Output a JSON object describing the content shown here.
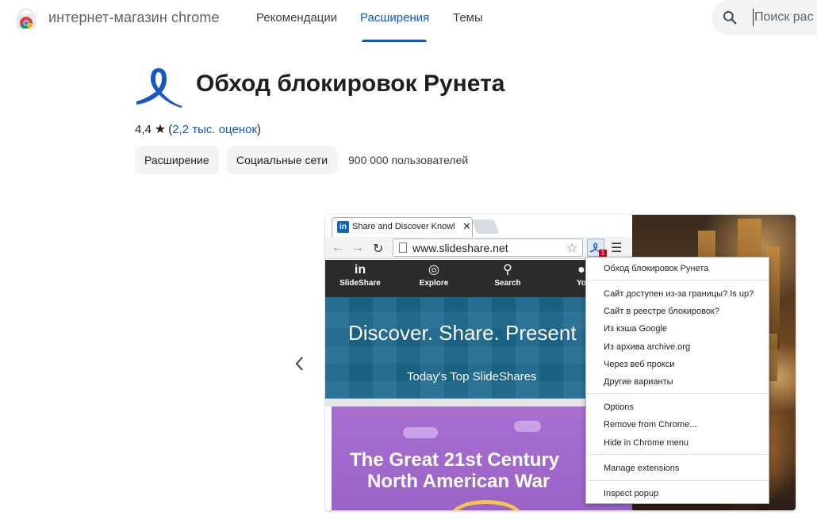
{
  "header": {
    "store_title": "интернет-магазин chrome",
    "tabs": [
      {
        "label": "Рекомендации"
      },
      {
        "label": "Расширения"
      },
      {
        "label": "Темы"
      }
    ],
    "active_tab": "Расширения",
    "search_placeholder": "Поиск рас"
  },
  "extension": {
    "title": "Обход блокировок Рунета",
    "rating": "4,4",
    "rating_count": "2,2 тыс. оценок",
    "chips": [
      "Расширение",
      "Социальные сети"
    ],
    "users": "900 000 пользователей"
  },
  "screenshot": {
    "tab_title": "Share and Discover Knowl",
    "url": "www.slideshare.net",
    "badge": "1",
    "favicon": "in",
    "nav": [
      {
        "icon": "in",
        "label": "SlideShare"
      },
      {
        "icon": "◎",
        "label": "Explore"
      },
      {
        "icon": "⚲",
        "label": "Search"
      },
      {
        "icon": "●",
        "label": "Yo"
      }
    ],
    "hero_title": "Discover. Share. Present",
    "hero_sub": "Today's Top SlideShares",
    "card_title_1": "The Great 21st Century",
    "card_title_2": "North American War",
    "popup": {
      "group1": [
        "Обход блокировок Рунета"
      ],
      "group2": [
        "Сайт доступен из-за границы? Is up?",
        "Сайт в реестре блокировок?",
        "Из кэша Google",
        "Из архива archive.org",
        "Через веб прокси",
        "Другие варианты"
      ],
      "group3": [
        "Options",
        "Remove from Chrome...",
        "Hide in Chrome menu"
      ],
      "group4": [
        "Manage extensions"
      ],
      "group5": [
        "Inspect popup"
      ]
    }
  },
  "colors": {
    "accent": "#0b57d0",
    "ribbon": "#1a56c4"
  }
}
